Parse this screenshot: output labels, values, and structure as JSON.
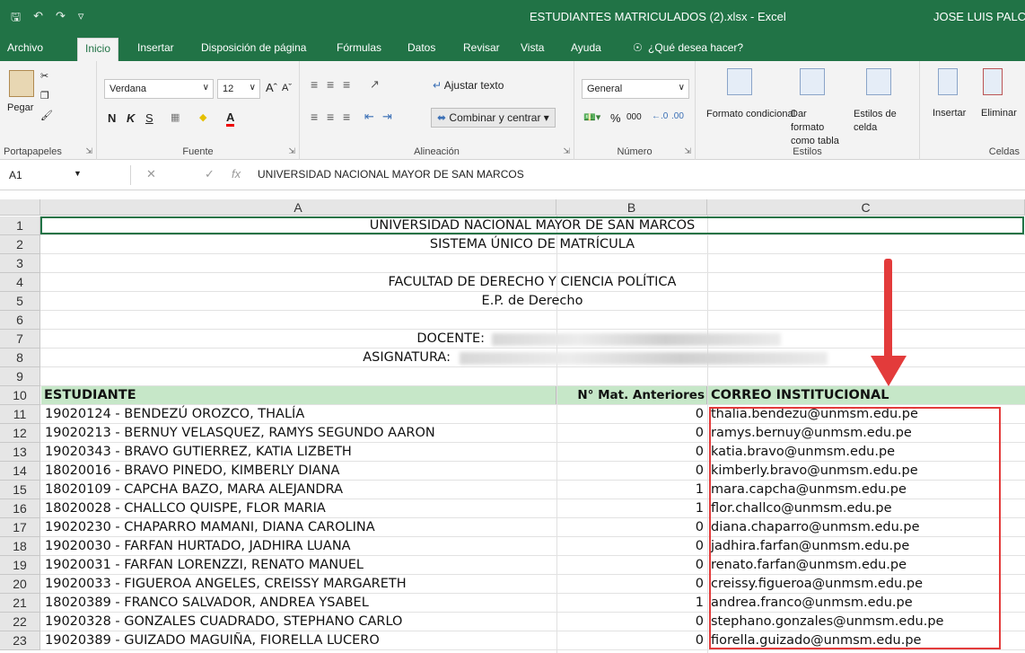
{
  "window": {
    "title": "ESTUDIANTES MATRICULADOS (2).xlsx  -  Excel",
    "user": "JOSE LUIS PALC"
  },
  "menu": [
    "Archivo",
    "Inicio",
    "Insertar",
    "Disposición de página",
    "Fórmulas",
    "Datos",
    "Revisar",
    "Vista",
    "Ayuda",
    "¿Qué desea hacer?"
  ],
  "ribbon": {
    "clipboard": {
      "paste": "Pegar",
      "label": "Portapapeles"
    },
    "font": {
      "name": "Verdana",
      "size": "12",
      "bold": "N",
      "italic": "K",
      "underline": "S",
      "label": "Fuente"
    },
    "alignment": {
      "wrap": "Ajustar texto",
      "merge": "Combinar y centrar",
      "label": "Alineación"
    },
    "number": {
      "format": "General",
      "percent": "%",
      "thousands": "000",
      "label": "Número"
    },
    "styles": {
      "conditional": "Formato condicional",
      "as_table": "Dar formato como tabla",
      "cell_styles": "Estilos de celda",
      "label": "Estilos"
    },
    "cells": {
      "insert": "Insertar",
      "delete": "Eliminar",
      "label": "Celdas"
    }
  },
  "formula_bar": {
    "cell_ref": "A1",
    "fx": "fx",
    "content": "UNIVERSIDAD NACIONAL MAYOR DE SAN MARCOS"
  },
  "columns": [
    "A",
    "B",
    "C"
  ],
  "header_rows": {
    "r1": "UNIVERSIDAD NACIONAL MAYOR DE SAN MARCOS",
    "r2": "SISTEMA ÚNICO DE MATRÍCULA",
    "r4": "FACULTAD DE DERECHO Y CIENCIA POLÍTICA",
    "r5": "E.P. de Derecho",
    "r7": "DOCENTE:",
    "r8": "ASIGNATURA:"
  },
  "table_header": {
    "student": "ESTUDIANTE",
    "prior": "N° Mat. Anteriores",
    "email": "CORREO INSTITUCIONAL"
  },
  "rows": [
    {
      "n": "11",
      "student": "19020124 - BENDEZÚ OROZCO, THALÍA",
      "prior": "0",
      "email": "thalia.bendezu@unmsm.edu.pe"
    },
    {
      "n": "12",
      "student": "19020213 - BERNUY VELASQUEZ, RAMYS SEGUNDO AARON",
      "prior": "0",
      "email": "ramys.bernuy@unmsm.edu.pe"
    },
    {
      "n": "13",
      "student": "19020343 - BRAVO GUTIERREZ, KATIA LIZBETH",
      "prior": "0",
      "email": "katia.bravo@unmsm.edu.pe"
    },
    {
      "n": "14",
      "student": "18020016 - BRAVO PINEDO, KIMBERLY DIANA",
      "prior": "0",
      "email": "kimberly.bravo@unmsm.edu.pe"
    },
    {
      "n": "15",
      "student": "18020109 - CAPCHA BAZO, MARA ALEJANDRA",
      "prior": "1",
      "email": "mara.capcha@unmsm.edu.pe"
    },
    {
      "n": "16",
      "student": "18020028 - CHALLCO QUISPE, FLOR MARIA",
      "prior": "1",
      "email": "flor.challco@unmsm.edu.pe"
    },
    {
      "n": "17",
      "student": "19020230 - CHAPARRO MAMANI, DIANA CAROLINA",
      "prior": "0",
      "email": "diana.chaparro@unmsm.edu.pe"
    },
    {
      "n": "18",
      "student": "19020030 - FARFAN HURTADO, JADHIRA LUANA",
      "prior": "0",
      "email": "jadhira.farfan@unmsm.edu.pe"
    },
    {
      "n": "19",
      "student": "19020031 - FARFAN LORENZZI, RENATO MANUEL",
      "prior": "0",
      "email": "renato.farfan@unmsm.edu.pe"
    },
    {
      "n": "20",
      "student": "19020033 - FIGUEROA ANGELES, CREISSY MARGARETH",
      "prior": "0",
      "email": "creissy.figueroa@unmsm.edu.pe"
    },
    {
      "n": "21",
      "student": "18020389 - FRANCO SALVADOR, ANDREA YSABEL",
      "prior": "1",
      "email": "andrea.franco@unmsm.edu.pe"
    },
    {
      "n": "22",
      "student": "19020328 - GONZALES CUADRADO, STEPHANO CARLO",
      "prior": "0",
      "email": "stephano.gonzales@unmsm.edu.pe"
    },
    {
      "n": "23",
      "student": "19020389 - GUIZADO MAGUIÑA, FIORELLA LUCERO",
      "prior": "0",
      "email": "fiorella.guizado@unmsm.edu.pe"
    }
  ],
  "colors": {
    "excel_green": "#217346",
    "header_green": "#c6e7c8",
    "annotation_red": "#e33b3b"
  }
}
